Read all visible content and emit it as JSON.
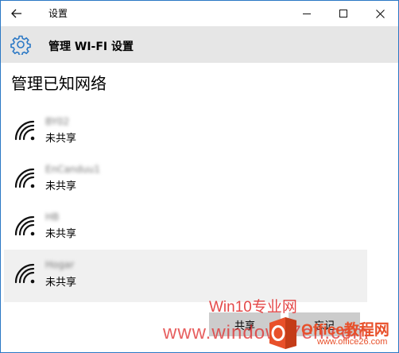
{
  "window": {
    "title": "设置",
    "back_icon": "back-arrow-icon",
    "minimize_icon": "minimize-icon",
    "maximize_icon": "maximize-icon",
    "close_icon": "close-icon"
  },
  "header": {
    "icon": "gear-icon",
    "title": "管理 WI-FI 设置"
  },
  "page_title": "管理已知网络",
  "networks": [
    {
      "name": "BY02",
      "status": "未共享",
      "icon": "wifi-signal-icon"
    },
    {
      "name": "EnCanduu1",
      "status": "未共享",
      "icon": "wifi-signal-icon"
    },
    {
      "name": "HB",
      "status": "未共享",
      "icon": "wifi-signal-icon"
    },
    {
      "name": "Hogar",
      "status": "未共享",
      "icon": "wifi-signal-icon"
    }
  ],
  "buttons": {
    "share": "共享",
    "forget": "忘记"
  },
  "watermark": {
    "text1": "Win10专业网",
    "text2": "www.windows7en.com",
    "brand": "Office教程网",
    "url": "www.office26.com"
  },
  "colors": {
    "header_bg": "#e6e6e6",
    "selected_bg": "#f0f0f0",
    "button_bg": "#cccccc",
    "accent": "#2b78c5",
    "watermark_red": "#e02a2a",
    "watermark_orange": "#e8502a"
  }
}
